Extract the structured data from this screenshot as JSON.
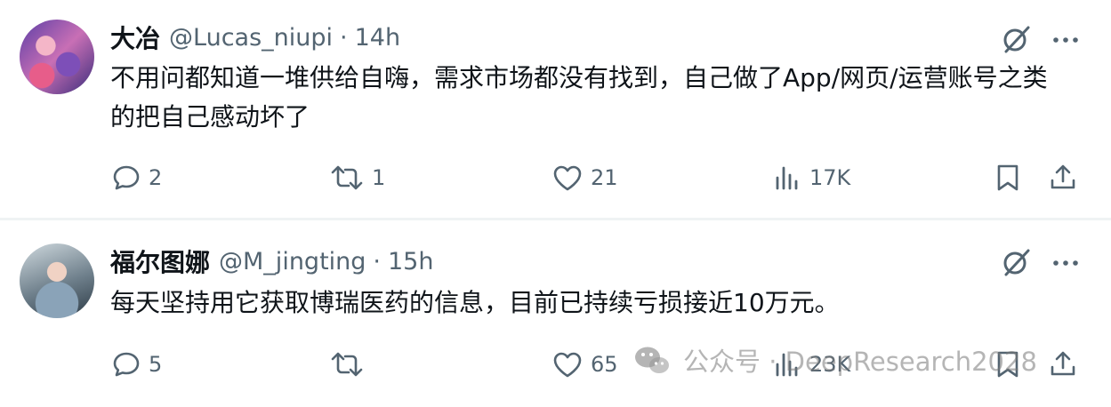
{
  "tweets": [
    {
      "display_name": "大冶",
      "handle": "@Lucas_niupi",
      "separator": "·",
      "time": "14h",
      "text": "不用问都知道一堆供给自嗨，需求市场都没有找到，自己做了App/网页/运营账号之类的把自己感动坏了",
      "replies": "2",
      "reposts": "1",
      "likes": "21",
      "views": "17K"
    },
    {
      "display_name": "福尔图娜",
      "handle": "@M_jingting",
      "separator": "·",
      "time": "15h",
      "text": "每天坚持用它获取博瑞医药的信息，目前已持续亏损接近10万元。",
      "replies": "5",
      "reposts": "",
      "likes": "65",
      "views": "23K"
    }
  ],
  "watermark": {
    "text": "公众号 · DeepResearch2028"
  },
  "colors": {
    "text_primary": "#0f1419",
    "text_secondary": "#536471",
    "divider": "#eff3f4"
  },
  "icons": [
    "grok-icon",
    "more-icon",
    "reply-icon",
    "repost-icon",
    "like-icon",
    "views-icon",
    "bookmark-icon",
    "share-icon",
    "wechat-icon"
  ]
}
